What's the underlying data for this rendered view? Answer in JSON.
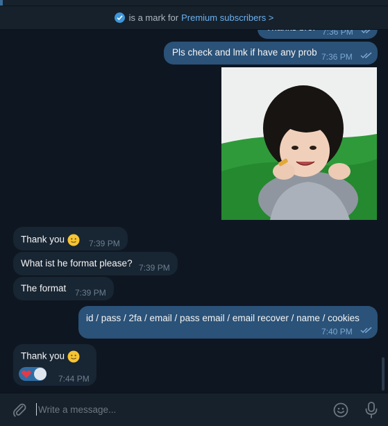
{
  "banner": {
    "prefix": "is a mark for",
    "link": "Premium subscribers >"
  },
  "messages": [
    {
      "direction": "out",
      "text": "Thanks bro!",
      "time": "7:36 PM",
      "status": "read"
    },
    {
      "direction": "out",
      "text": "Pls check and lmk if have any prob",
      "time": "7:36 PM",
      "status": "read"
    },
    {
      "direction": "out",
      "type": "photo",
      "description": "sticker"
    },
    {
      "direction": "in",
      "text": "Thank you",
      "emoji": "slightly-smiling-face",
      "time": "7:39 PM"
    },
    {
      "direction": "in",
      "text": "What ist he format please?",
      "time": "7:39 PM"
    },
    {
      "direction": "in",
      "text": "The format",
      "time": "7:39 PM"
    },
    {
      "direction": "out",
      "text": "id / pass / 2fa / email / pass email / email recover / name / cookies",
      "time": "7:40 PM",
      "status": "read"
    },
    {
      "direction": "in",
      "text": "Thank you",
      "emoji": "slightly-smiling-face",
      "time": "7:44 PM",
      "reaction": "red-heart"
    }
  ],
  "composer": {
    "placeholder": "Write a message..."
  },
  "colors": {
    "background": "#0e1621",
    "incoming": "#182533",
    "outgoing": "#2b5278",
    "accent": "#6ab2f2"
  }
}
